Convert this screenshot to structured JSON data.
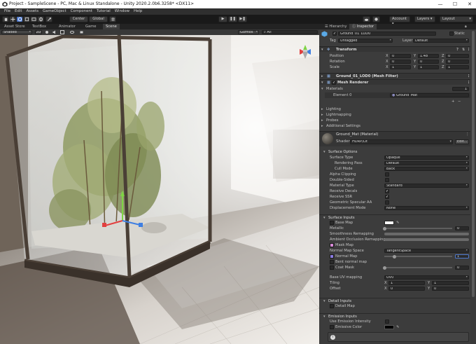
{
  "window": {
    "title": "Project - SampleScene - PC, Mac & Linux Standalone - Unity 2020.2.0b6.3258* <DX11>",
    "controls": [
      "—",
      "☐",
      "✕"
    ]
  },
  "menu": [
    "File",
    "Edit",
    "Assets",
    "GameObject",
    "Component",
    "Tutorial",
    "Window",
    "Help"
  ],
  "toolbar": {
    "pivot_label": "Center",
    "space_label": "Global",
    "play_icon": "▶",
    "pause_icon": "❚❚",
    "step_icon": "▶❚",
    "account_label": "Account",
    "layers_label": "Layers",
    "layout_label": "Layout"
  },
  "scene_tabs": [
    "Asset Store",
    "TextBox",
    "Animator",
    "Game",
    "Scene"
  ],
  "scene_bar": {
    "shading": "Shaded",
    "mode_2d": "2D",
    "gizmos": "Gizmos",
    "search_placeholder": "All"
  },
  "inspector_tabs": [
    "Hierarchy",
    "Inspector"
  ],
  "object": {
    "name": "Ground_01_LOD0",
    "static_label": "Static",
    "tag_label": "Tag",
    "tag_value": "Untagged",
    "layer_label": "Layer",
    "layer_value": "Default"
  },
  "transform": {
    "header": "Transform",
    "rows": [
      {
        "label": "Position",
        "x": "0",
        "y": "1.48",
        "z": "0"
      },
      {
        "label": "Rotation",
        "x": "0",
        "y": "0",
        "z": "0"
      },
      {
        "label": "Scale",
        "x": "1",
        "y": "1",
        "z": "1"
      }
    ],
    "axis": [
      "X",
      "Y",
      "Z"
    ]
  },
  "mesh_filter_header": "Ground_01_LOD0 (Mesh Filter)",
  "mesh_renderer": {
    "header": "Mesh Renderer",
    "materials_label": "Materials",
    "materials_count": "1",
    "element_label": "Element 0",
    "element_value": "Ground_Mat",
    "foldouts": [
      "Lighting",
      "Lightmapping",
      "Probes",
      "Additional Settings"
    ]
  },
  "material": {
    "name": "Ground_Mat (Material)",
    "shader_label": "Shader",
    "shader_value": "HDRP/Lit",
    "edit_label": "Edit..."
  },
  "surface_options": {
    "header": "Surface Options",
    "surface_type": {
      "label": "Surface Type",
      "value": "Opaque"
    },
    "rendering_pass": {
      "label": "Rendering Pass",
      "value": "Default"
    },
    "cull_mode": {
      "label": "Cull Mode",
      "value": "Back"
    },
    "alpha_clipping": "Alpha Clipping",
    "double_sided": "Double-Sided",
    "material_type": {
      "label": "Material Type",
      "value": "Standard"
    },
    "receive_decals": "Receive Decals",
    "receive_ssr": "Receive SSR",
    "geometric_aa": "Geometric Specular AA",
    "displacement_mode": {
      "label": "Displacement Mode",
      "value": "None"
    }
  },
  "surface_inputs": {
    "header": "Surface Inputs",
    "base_map": "Base Map",
    "metallic": {
      "label": "Metallic",
      "value": "0"
    },
    "smoothness_remap": "Smoothness Remapping",
    "ao_remap": "Ambient Occlusion Remapping",
    "mask_map": "Mask Map",
    "normal_space": {
      "label": "Normal Map Space",
      "value": "TangentSpace"
    },
    "normal_map": {
      "label": "Normal Map",
      "value": "1"
    },
    "bent_normal": "Bent normal map",
    "coat_mask": {
      "label": "Coat Mask",
      "value": "0"
    },
    "base_uv": {
      "label": "Base UV mapping",
      "value": "UV0"
    },
    "tiling": {
      "label": "Tiling",
      "x": "1",
      "y": "1"
    },
    "offset": {
      "label": "Offset",
      "x": "0",
      "y": "0"
    }
  },
  "detail_inputs": {
    "header": "Detail Inputs",
    "detail_map": "Detail Map"
  },
  "emission_inputs": {
    "header": "Emission Inputs",
    "use_intensity": "Use Emission Intensity",
    "emissive_color": "Emissive Color"
  },
  "colors": {
    "accent": "#4d78cc",
    "panel": "#3c3c3c",
    "header": "#353535",
    "field": "#2a2a2a",
    "gizmo_x": "#e23f3f",
    "gizmo_y": "#7ed444",
    "gizmo_z": "#3f7fe2"
  }
}
